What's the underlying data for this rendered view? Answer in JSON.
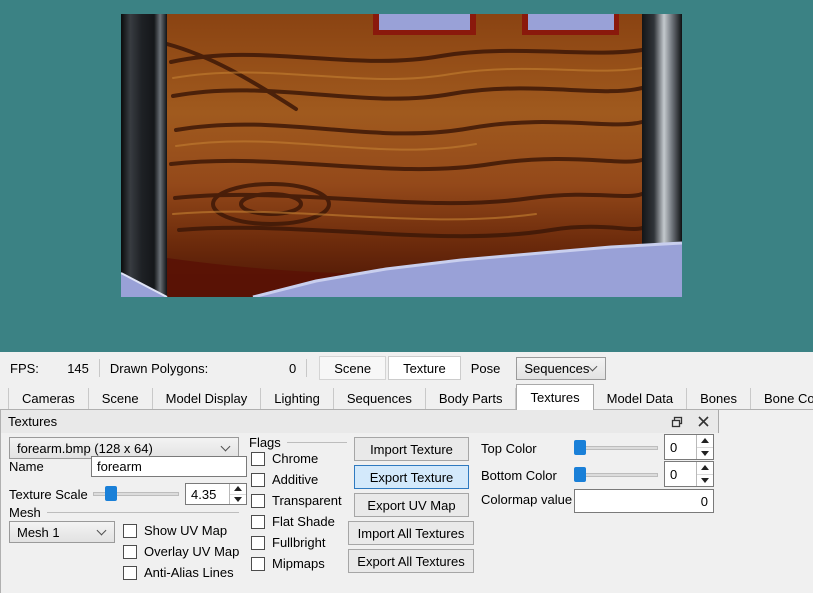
{
  "colors": {
    "viewport_bg": "#3b8284",
    "panel_bg": "#f0f0f0",
    "accent_blue": "#1a80d8",
    "export_button_bg": "#d3e9fb",
    "export_button_border": "#2f7ac0",
    "wood_base": "#9a5019",
    "metal_dark": "#17191c",
    "lavender": "#99a1d7"
  },
  "status_bar": {
    "fps_label": "FPS:",
    "fps_value": "145",
    "polygons_label": "Drawn Polygons:",
    "polygons_value": "0",
    "scene_button": "Scene",
    "texture_button": "Texture",
    "pose_button": "Pose",
    "sequences_select": "Sequences"
  },
  "tabs": {
    "items": [
      "Cameras",
      "Scene",
      "Model Display",
      "Lighting",
      "Sequences",
      "Body Parts",
      "Textures",
      "Model Data",
      "Bones",
      "Bone Controllers"
    ],
    "active": "Textures"
  },
  "panel": {
    "title": "Textures",
    "texture_select_value": "forearm.bmp (128 x 64)",
    "name": {
      "label": "Name",
      "value": "forearm"
    },
    "texture_scale": {
      "label": "Texture Scale",
      "value": "4.35"
    },
    "mesh": {
      "label": "Mesh",
      "select_value": "Mesh 1",
      "checkboxes": [
        "Show UV Map",
        "Overlay UV Map",
        "Anti-Alias Lines"
      ]
    },
    "flags": {
      "label": "Flags",
      "items": [
        "Chrome",
        "Additive",
        "Transparent",
        "Flat Shade",
        "Fullbright",
        "Mipmaps"
      ]
    },
    "buttons": [
      "Import Texture",
      "Export Texture",
      "Export UV Map",
      "Import All Textures",
      "Export All Textures"
    ],
    "colors_section": {
      "top_color": {
        "label": "Top Color",
        "value": "0"
      },
      "bottom_color": {
        "label": "Bottom Color",
        "value": "0"
      },
      "colormap": {
        "label": "Colormap value",
        "value": "0"
      }
    }
  }
}
